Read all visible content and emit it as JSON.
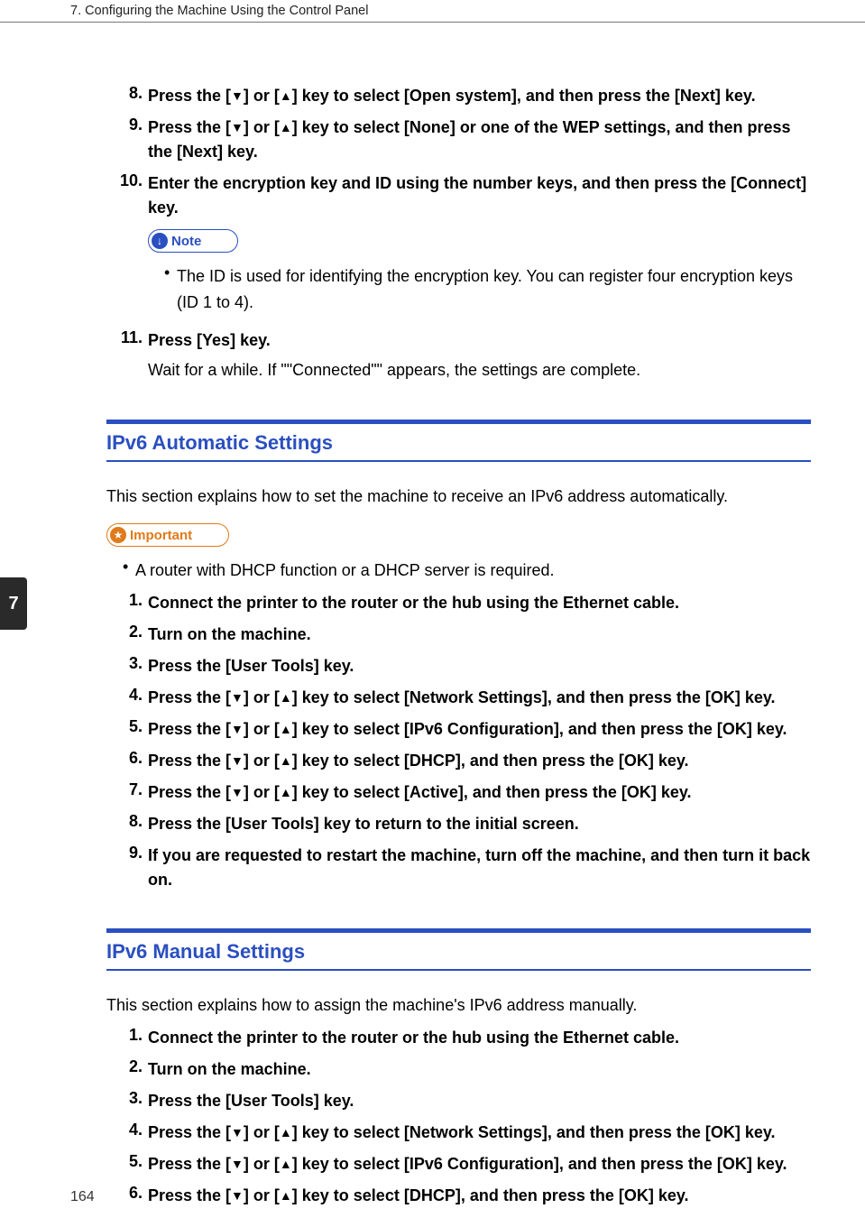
{
  "header": "7. Configuring the Machine Using the Control Panel",
  "side_tab": "7",
  "page_number": "164",
  "glyphs": {
    "down": "▼",
    "up": "▲",
    "bullet": "•",
    "note_icon": "↓",
    "important_icon": "★"
  },
  "callouts": {
    "note": "Note",
    "important": "Important"
  },
  "top_steps": [
    {
      "num": "8.",
      "parts": [
        "Press the [",
        "DOWN",
        "] or [",
        "UP",
        "] key to select [Open system], and then press the [Next] key."
      ]
    },
    {
      "num": "9.",
      "parts": [
        "Press the [",
        "DOWN",
        "] or [",
        "UP",
        "] key to select [None] or one of the WEP settings, and then press the [Next] key."
      ]
    },
    {
      "num": "10.",
      "parts": [
        "Enter the encryption key and ID using the number keys, and then press the [Connect] key."
      ],
      "note_bullets": [
        "The ID is used for identifying the encryption key. You can register four encryption keys (ID 1 to 4)."
      ]
    },
    {
      "num": "11.",
      "parts": [
        "Press [Yes] key."
      ],
      "followup": "Wait for a while. If \"\"Connected\"\" appears, the settings are complete."
    }
  ],
  "section_auto": {
    "title": "IPv6 Automatic Settings",
    "intro": "This section explains how to set the machine to receive an IPv6 address automatically.",
    "important_bullets": [
      "A router with DHCP function or a DHCP server is required."
    ],
    "steps": [
      {
        "num": "1.",
        "parts": [
          "Connect the printer to the router or the hub using the Ethernet cable."
        ]
      },
      {
        "num": "2.",
        "parts": [
          "Turn on the machine."
        ]
      },
      {
        "num": "3.",
        "parts": [
          "Press the [User Tools] key."
        ]
      },
      {
        "num": "4.",
        "parts": [
          "Press the [",
          "DOWN",
          "] or [",
          "UP",
          "] key to select [Network Settings], and then press the [OK] key."
        ]
      },
      {
        "num": "5.",
        "parts": [
          "Press the [",
          "DOWN",
          "] or [",
          "UP",
          "] key to select [IPv6 Configuration], and then press the [OK] key."
        ]
      },
      {
        "num": "6.",
        "parts": [
          "Press the [",
          "DOWN",
          "] or [",
          "UP",
          "] key to select [DHCP], and then press the [OK] key."
        ]
      },
      {
        "num": "7.",
        "parts": [
          "Press the [",
          "DOWN",
          "] or [",
          "UP",
          "] key to select [Active], and then press the [OK] key."
        ]
      },
      {
        "num": "8.",
        "parts": [
          "Press the [User Tools] key to return to the initial screen."
        ]
      },
      {
        "num": "9.",
        "parts": [
          "If you are requested to restart the machine, turn off the machine, and then turn it back on."
        ]
      }
    ]
  },
  "section_manual": {
    "title": "IPv6 Manual Settings",
    "intro": "This section explains how to assign the machine's IPv6 address manually.",
    "steps": [
      {
        "num": "1.",
        "parts": [
          "Connect the printer to the router or the hub using the Ethernet cable."
        ]
      },
      {
        "num": "2.",
        "parts": [
          "Turn on the machine."
        ]
      },
      {
        "num": "3.",
        "parts": [
          "Press the [User Tools] key."
        ]
      },
      {
        "num": "4.",
        "parts": [
          "Press the [",
          "DOWN",
          "] or [",
          "UP",
          "] key to select [Network Settings], and then press the [OK] key."
        ]
      },
      {
        "num": "5.",
        "parts": [
          "Press the [",
          "DOWN",
          "] or [",
          "UP",
          "] key to select [IPv6 Configuration], and then press the [OK] key."
        ]
      },
      {
        "num": "6.",
        "parts": [
          "Press the [",
          "DOWN",
          "] or [",
          "UP",
          "] key to select [DHCP], and then press the [OK] key."
        ]
      }
    ]
  }
}
